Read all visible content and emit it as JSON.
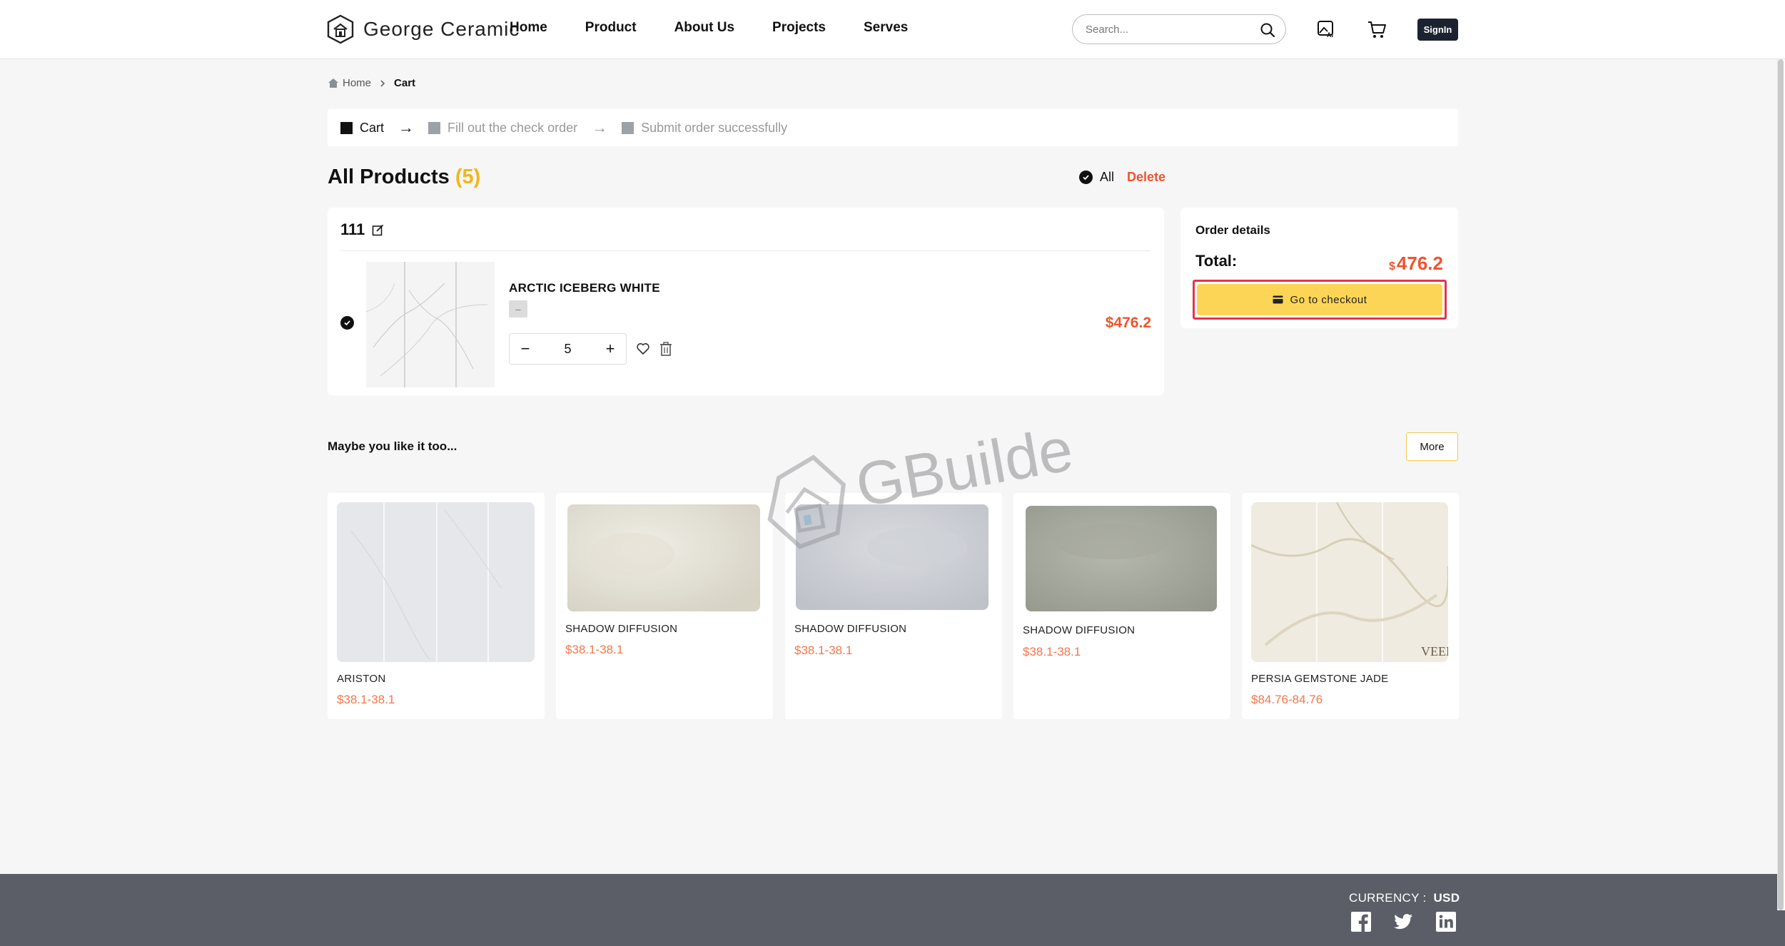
{
  "header": {
    "brand": "George Ceramic",
    "nav": [
      "Home",
      "Product",
      "About Us",
      "Projects",
      "Serves"
    ],
    "search_placeholder": "Search...",
    "signin_label": "SignIn"
  },
  "breadcrumb": {
    "home": "Home",
    "current": "Cart"
  },
  "steps": [
    {
      "label": "Cart",
      "active": true
    },
    {
      "label": "Fill out the check order",
      "active": false
    },
    {
      "label": "Submit order successfully",
      "active": false
    }
  ],
  "cart": {
    "title": "All Products",
    "count": "(5)",
    "select_all_label": "All",
    "delete_label": "Delete",
    "store_name": "111",
    "item": {
      "name": "ARCTIC ICEBERG WHITE",
      "tag": "–",
      "quantity": "5",
      "price": "$476.2"
    }
  },
  "order": {
    "title": "Order details",
    "total_label": "Total:",
    "currency_symbol": "$",
    "total_value": "476.2",
    "checkout_label": "Go to checkout"
  },
  "recommendations": {
    "title": "Maybe you like it too...",
    "more_label": "More",
    "items": [
      {
        "name": "ARISTON",
        "price": "$38.1-38.1"
      },
      {
        "name": "SHADOW DIFFUSION",
        "price": "$38.1-38.1"
      },
      {
        "name": "SHADOW DIFFUSION",
        "price": "$38.1-38.1"
      },
      {
        "name": "SHADOW DIFFUSION",
        "price": "$38.1-38.1"
      },
      {
        "name": "PERSIA GEMSTONE JADE",
        "price": "$84.76-84.76"
      }
    ]
  },
  "watermark_text": "GBuilder",
  "footer": {
    "currency_label": "CURRENCY :",
    "currency_value": "USD"
  },
  "colors": {
    "accent_yellow": "#fdd556",
    "price_red": "#f0532e",
    "footer_gray": "#5b5e66"
  }
}
